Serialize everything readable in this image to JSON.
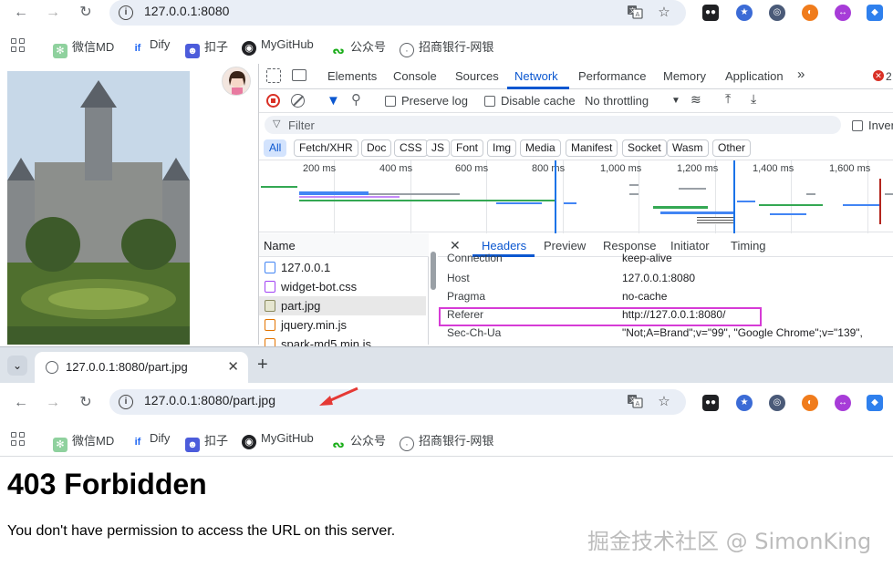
{
  "top_window": {
    "url": "127.0.0.1:8080",
    "bookmarks": [
      "微信MD",
      "Dify",
      "扣子",
      "MyGitHub",
      "公众号",
      "招商银行-网银"
    ]
  },
  "devtools": {
    "tabs": [
      "Elements",
      "Console",
      "Sources",
      "Network",
      "Performance",
      "Memory",
      "Application"
    ],
    "active_tab": "Network",
    "more": "»",
    "error_count": "2",
    "toolbar": {
      "preserve_log": "Preserve log",
      "disable_cache": "Disable cache",
      "throttling": "No throttling"
    },
    "filter_placeholder": "Filter",
    "invert_label": "Inver",
    "type_filters": [
      "All",
      "Fetch/XHR",
      "Doc",
      "CSS",
      "JS",
      "Font",
      "Img",
      "Media",
      "Manifest",
      "Socket",
      "Wasm",
      "Other"
    ],
    "timeline_ticks": [
      "200 ms",
      "400 ms",
      "600 ms",
      "800 ms",
      "1,000 ms",
      "1,200 ms",
      "1,400 ms",
      "1,600 ms"
    ],
    "name_header": "Name",
    "files": [
      "127.0.0.1",
      "widget-bot.css",
      "part.jpg",
      "jquery.min.js",
      "spark-md5.min.js"
    ],
    "selected_file": "part.jpg",
    "detail_close": "✕",
    "detail_tabs": [
      "Headers",
      "Preview",
      "Response",
      "Initiator",
      "Timing"
    ],
    "headers": [
      {
        "key": "Connection",
        "value": "keep-alive"
      },
      {
        "key": "Host",
        "value": "127.0.0.1:8080"
      },
      {
        "key": "Pragma",
        "value": "no-cache"
      },
      {
        "key": "Referer",
        "value": "http://127.0.0.1:8080/"
      },
      {
        "key": "Sec-Ch-Ua",
        "value": "\"Not;A=Brand\";v=\"99\", \"Google Chrome\";v=\"139\","
      }
    ],
    "highlighted_header": "Referer",
    "highlight_color": "#d63bd6"
  },
  "bottom_window": {
    "tab_title": "127.0.0.1:8080/part.jpg",
    "tab_close": "✕",
    "new_tab": "+",
    "url": "127.0.0.1:8080/part.jpg",
    "bookmarks": [
      "微信MD",
      "Dify",
      "扣子",
      "MyGitHub",
      "公众号",
      "招商银行-网银"
    ],
    "heading": "403 Forbidden",
    "message": "You don't have permission to access the URL on this server.",
    "arrow_color": "#e53935"
  },
  "watermark": "掘金技术社区 @ SimonKing"
}
